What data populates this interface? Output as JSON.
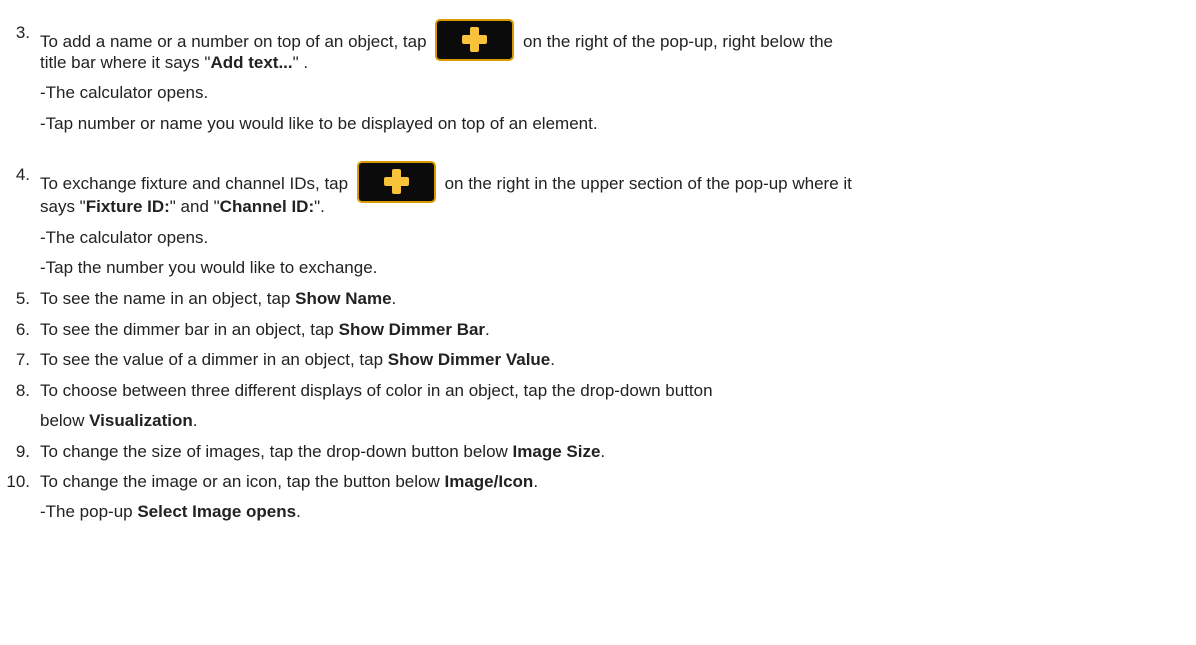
{
  "steps": [
    {
      "number": "3.",
      "lines": [
        {
          "before": "To add a name or a number on top of an object, tap",
          "after": "on the right of the pop-up, right below the"
        },
        {
          "text1": "title bar where it says \"",
          "bold1": "Add text...",
          "text2": "\" ."
        },
        {
          "text": "-The calculator opens."
        },
        {
          "text": "-Tap number or name you would like to be displayed on top of an element."
        }
      ],
      "button_icon": "plus-icon"
    },
    {
      "number": "4.",
      "lines": [
        {
          "before": "To exchange fixture and channel IDs, tap",
          "after": "on the right in the upper section of the pop-up where it"
        },
        {
          "text1": "says \"",
          "bold1": "Fixture ID:",
          "text2": "\" and \"",
          "bold2": "Channel ID:",
          "text3": "\"."
        },
        {
          "text": "-The calculator opens."
        },
        {
          "text": "-Tap the number you would like to exchange."
        }
      ],
      "button_icon": "plus-icon"
    },
    {
      "number": "5.",
      "text": "To see the name in an object, tap ",
      "bold": "Show Name",
      "end": "."
    },
    {
      "number": "6.",
      "text": "To see the dimmer bar in an object, tap ",
      "bold": "Show Dimmer Bar",
      "end": "."
    },
    {
      "number": "7.",
      "text": "To see the value of a dimmer in an object, tap ",
      "bold": "Show Dimmer Value",
      "end": "."
    },
    {
      "number": "8.",
      "text": "To choose between three different displays of color in an object, tap the drop-down button",
      "line2_text": "below ",
      "line2_bold": "Visualization",
      "line2_end": "."
    },
    {
      "number": "9.",
      "text": "To change the size of images, tap the drop-down button below ",
      "bold": "Image Size",
      "end": "."
    },
    {
      "number": "10.",
      "text": "To change the image or an icon, tap the button below ",
      "bold": "Image/Icon",
      "end": ".",
      "line2_text": "-The pop-up ",
      "line2_bold": "Select Image opens",
      "line2_end": "."
    }
  ],
  "colors": {
    "text": "#222222",
    "button_bg": "#0b0b0b",
    "button_border": "#d89a00",
    "plus": "#f8c33a"
  }
}
